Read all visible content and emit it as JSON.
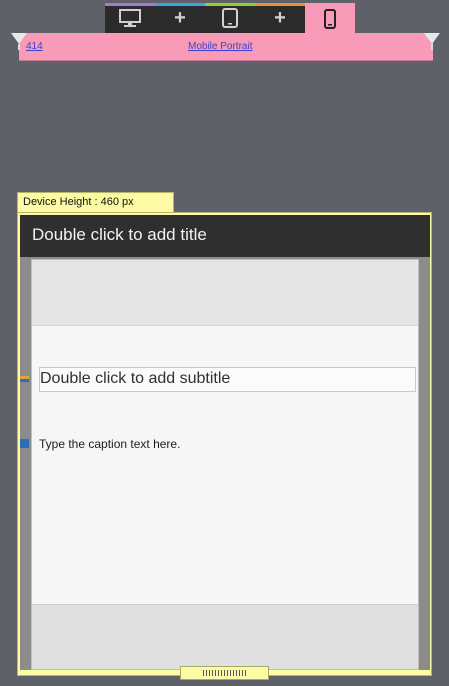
{
  "devices": [
    {
      "name": "desktop",
      "icon": "monitor-icon",
      "stripe": "#9b7dd1"
    },
    {
      "name": "add-1",
      "icon": "plus-icon",
      "label": "+",
      "stripe": "#38a7d8"
    },
    {
      "name": "tablet",
      "icon": "tablet-icon",
      "stripe": "#8ccf3c"
    },
    {
      "name": "add-2",
      "icon": "plus-icon",
      "label": "+",
      "stripe": "#e8904a"
    },
    {
      "name": "mobile",
      "icon": "phone-icon",
      "stripe": "#f79bb9",
      "active": true
    }
  ],
  "ruler": {
    "width_label": "414",
    "preset_label": "Mobile Portrait",
    "color": "#f79bb9"
  },
  "device_height_label": "Device Height : 460 px",
  "slide": {
    "title_placeholder": "Double click to add title",
    "subtitle_placeholder": "Double click to add subtitle",
    "caption_placeholder": "Type the caption text here."
  }
}
